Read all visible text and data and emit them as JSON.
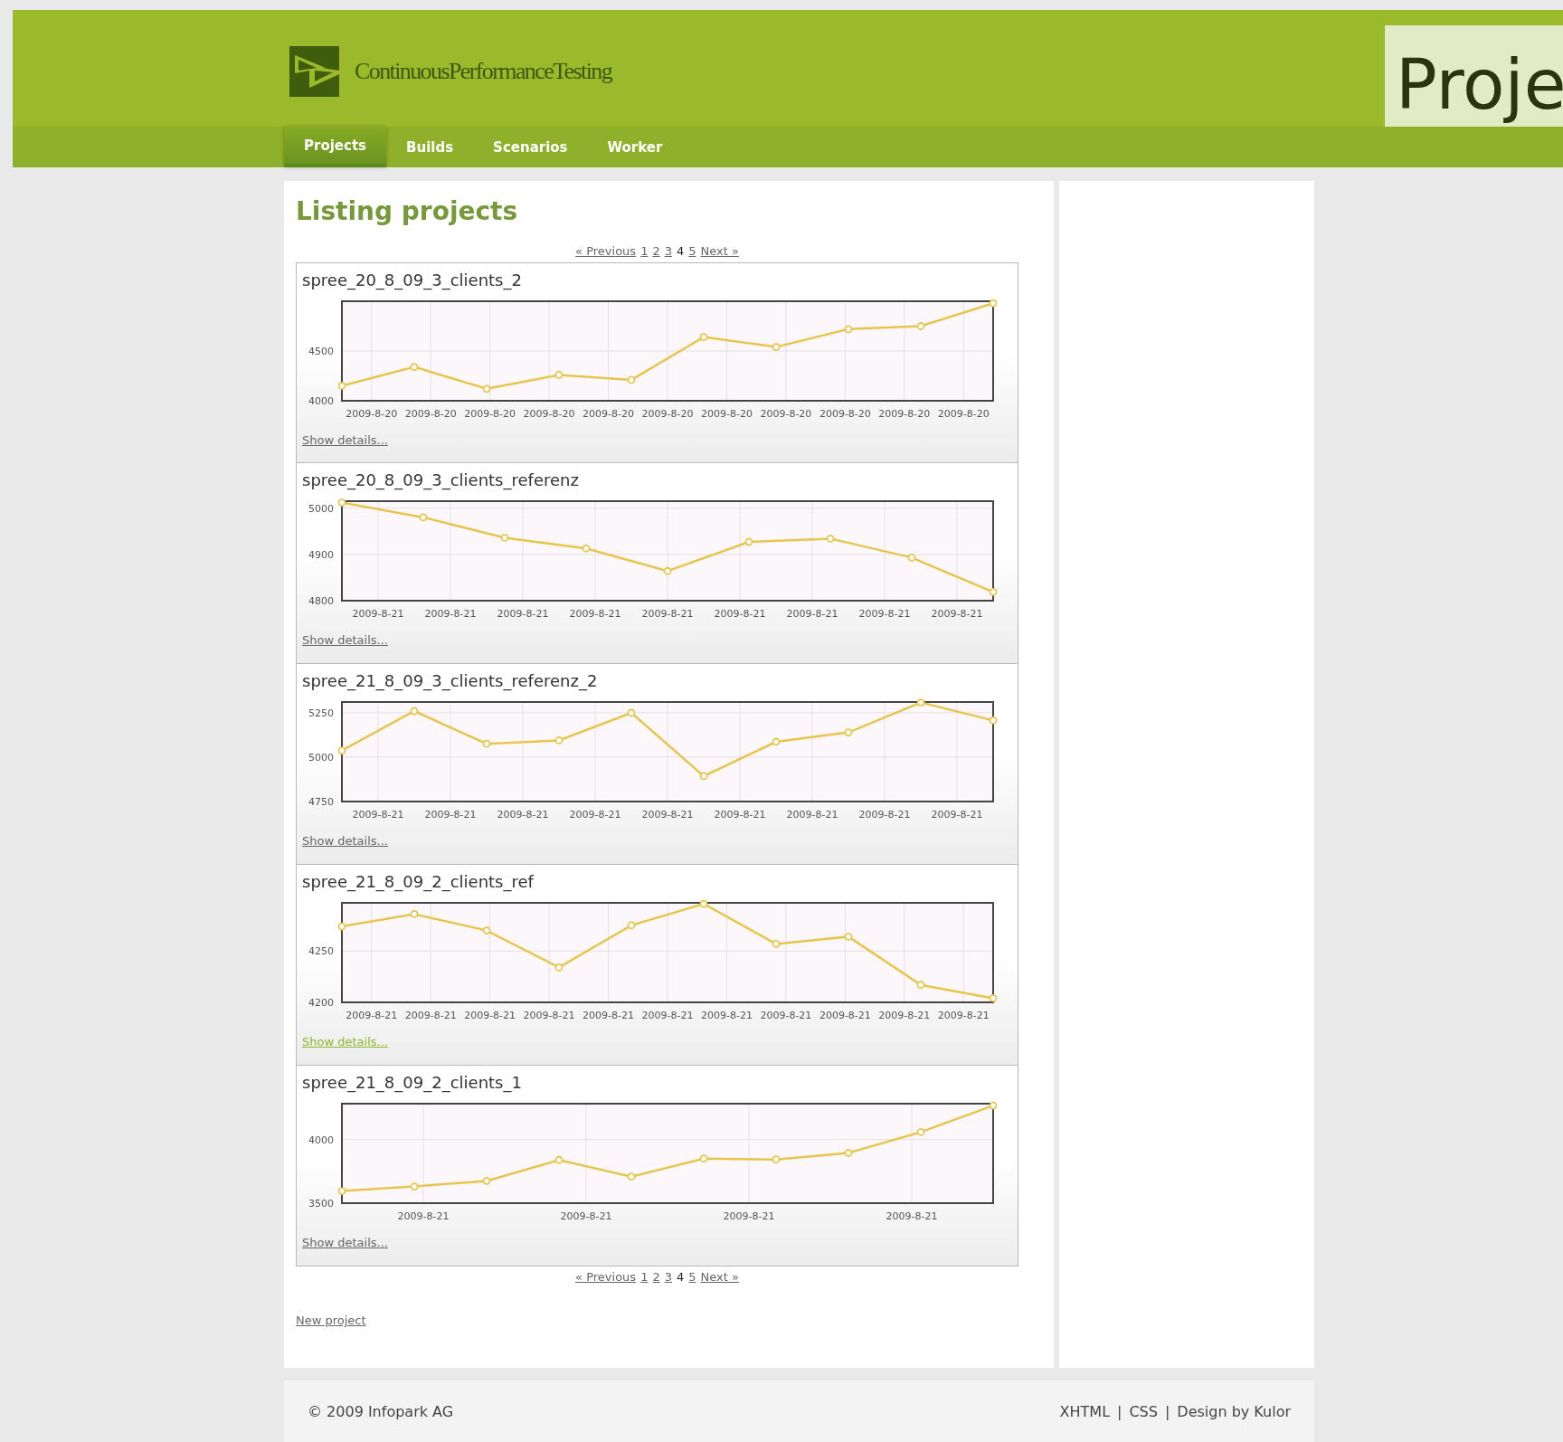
{
  "header": {
    "logo_text": "ContinuousPerformanceTesting",
    "page_title": "Proje"
  },
  "nav": {
    "tabs": [
      {
        "label": "Projects",
        "selected": true
      },
      {
        "label": "Builds",
        "selected": false
      },
      {
        "label": "Scenarios",
        "selected": false
      },
      {
        "label": "Worker",
        "selected": false
      }
    ]
  },
  "main": {
    "heading": "Listing projects",
    "pagination_top": {
      "previous": "« Previous",
      "next": "Next »",
      "pages": [
        {
          "label": "1",
          "selected": false
        },
        {
          "label": "2",
          "selected": false
        },
        {
          "label": "3",
          "selected": false
        },
        {
          "label": "4",
          "selected": true
        },
        {
          "label": "5",
          "selected": false
        }
      ]
    },
    "projects": [
      {
        "name": "spree_20_8_09_3_clients_2",
        "link": "Show details...",
        "hovered": false,
        "axis_labels": [
          "2009-8-20",
          "2009-8-20",
          "2009-8-20",
          "2009-8-20",
          "2009-8-20",
          "2009-8-20",
          "2009-8-20",
          "2009-8-20",
          "2009-8-20",
          "2009-8-20",
          "2009-8-20"
        ],
        "chart_data": {
          "type": "line",
          "marker": true,
          "grid": true,
          "values": [
            4150,
            4340,
            4120,
            4260,
            4210,
            4640,
            4540,
            4720,
            4750,
            4980
          ],
          "ylim": [
            4000,
            5000
          ],
          "yticks": [
            4000,
            4500
          ]
        }
      },
      {
        "name": "spree_20_8_09_3_clients_referenz",
        "link": "Show details...",
        "hovered": false,
        "axis_labels": [
          "2009-8-21",
          "2009-8-21",
          "2009-8-21",
          "2009-8-21",
          "2009-8-21",
          "2009-8-21",
          "2009-8-21",
          "2009-8-21",
          "2009-8-21"
        ],
        "chart_data": {
          "type": "line",
          "marker": true,
          "grid": true,
          "values": [
            5012,
            4980,
            4936,
            4913,
            4864,
            4927,
            4934,
            4893,
            4819
          ],
          "ylim": [
            4800,
            5015
          ],
          "yticks": [
            4800,
            4900,
            5000
          ]
        }
      },
      {
        "name": "spree_21_8_09_3_clients_referenz_2",
        "link": "Show details...",
        "hovered": false,
        "axis_labels": [
          "2009-8-21",
          "2009-8-21",
          "2009-8-21",
          "2009-8-21",
          "2009-8-21",
          "2009-8-21",
          "2009-8-21",
          "2009-8-21",
          "2009-8-21"
        ],
        "chart_data": {
          "type": "line",
          "marker": true,
          "grid": true,
          "values": [
            5037,
            5259,
            5075,
            5094,
            5249,
            4893,
            5086,
            5139,
            5307,
            5206
          ],
          "ylim": [
            4750,
            5310
          ],
          "yticks": [
            4750,
            5000,
            5250
          ]
        }
      },
      {
        "name": "spree_21_8_09_2_clients_ref",
        "link": "Show details...",
        "hovered": true,
        "axis_labels": [
          "2009-8-21",
          "2009-8-21",
          "2009-8-21",
          "2009-8-21",
          "2009-8-21",
          "2009-8-21",
          "2009-8-21",
          "2009-8-21",
          "2009-8-21",
          "2009-8-21",
          "2009-8-21"
        ],
        "chart_data": {
          "type": "line",
          "marker": true,
          "grid": true,
          "values": [
            4274,
            4286,
            4270,
            4234,
            4275,
            4296,
            4257,
            4264,
            4217,
            4204
          ],
          "ylim": [
            4200,
            4297
          ],
          "yticks": [
            4200,
            4250
          ]
        }
      },
      {
        "name": "spree_21_8_09_2_clients_1",
        "link": "Show details...",
        "hovered": false,
        "axis_labels": [
          "2009-8-21",
          "2009-8-21",
          "2009-8-21",
          "2009-8-21"
        ],
        "chart_data": {
          "type": "line",
          "marker": true,
          "grid": true,
          "values": [
            3595,
            3631,
            3675,
            3839,
            3708,
            3850,
            3843,
            3894,
            4058,
            4266
          ],
          "ylim": [
            3500,
            4281
          ],
          "yticks": [
            3500,
            4000
          ]
        }
      }
    ],
    "pagination_bottom": {
      "previous": "« Previous",
      "next": "Next »",
      "pages": [
        {
          "label": "1",
          "selected": false
        },
        {
          "label": "2",
          "selected": false
        },
        {
          "label": "3",
          "selected": false
        },
        {
          "label": "4",
          "selected": true
        },
        {
          "label": "5",
          "selected": false
        }
      ]
    },
    "new_project_link": "New project"
  },
  "footer": {
    "copyright": "© 2009 Infopark AG",
    "separator": "|",
    "links": [
      {
        "label": "XHTML"
      },
      {
        "label": "CSS"
      },
      {
        "label": "Design by Kulor"
      }
    ]
  }
}
